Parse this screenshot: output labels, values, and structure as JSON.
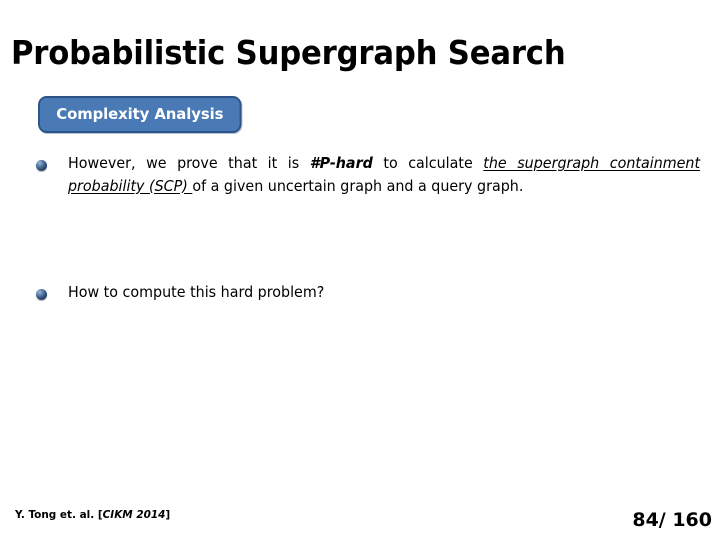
{
  "slide": {
    "title": "Probabilistic Supergraph Search",
    "background_color": "#ffffff",
    "badge": {
      "label": "Complexity Analysis",
      "fill_color": "#4a7ab5",
      "border_color": "#2d5489",
      "text_color": "#ffffff"
    },
    "bullets": [
      {
        "marker": "sphere-bullet-icon",
        "justified": true,
        "segments": [
          {
            "text": "However, we prove that it is ",
            "style": "normal"
          },
          {
            "text": "#P-hard",
            "style": "bold-italic"
          },
          {
            "text": " to calculate ",
            "style": "normal"
          },
          {
            "text": "the supergraph containment probability (SCP) ",
            "style": "italic-underline"
          },
          {
            "text": "of a given uncertain graph and a query graph.",
            "style": "normal"
          }
        ]
      },
      {
        "marker": "sphere-bullet-icon",
        "justified": false,
        "segments": [
          {
            "text": "How to compute this hard problem?",
            "style": "normal"
          }
        ]
      }
    ],
    "footer": {
      "credit_prefix": "Y. Tong et. al. [",
      "credit_venue": "CIKM 2014",
      "credit_suffix": "]",
      "page_indicator": "84/ 160"
    }
  }
}
